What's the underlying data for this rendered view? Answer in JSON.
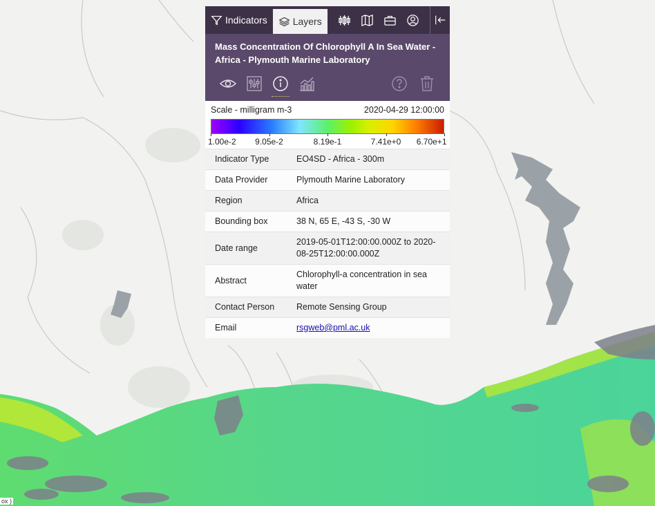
{
  "tabs": {
    "indicators": "Indicators",
    "layers": "Layers"
  },
  "toolbar_icons": [
    "compare-icon",
    "map-icon",
    "briefcase-icon",
    "user-icon",
    "collapse-left-icon"
  ],
  "layer": {
    "title": "Mass Concentration Of Chlorophyll A In Sea Water - Africa - Plymouth Marine Laboratory",
    "tools": [
      "eye-icon",
      "sliders-icon",
      "info-icon",
      "chart-icon",
      "help-icon",
      "trash-icon"
    ]
  },
  "legend": {
    "scale_label": "Scale - milligram m-3",
    "date": "2020-04-29 12:00:00",
    "ticks": [
      "1.00e-2",
      "9.05e-2",
      "8.19e-1",
      "7.41e+0",
      "6.70e+1"
    ]
  },
  "metadata": [
    {
      "key": "Indicator Type",
      "value": "EO4SD - Africa - 300m"
    },
    {
      "key": "Data Provider",
      "value": "Plymouth Marine Laboratory"
    },
    {
      "key": "Region",
      "value": "Africa"
    },
    {
      "key": "Bounding box",
      "value": "38 N, 65 E, -43 S, -30 W"
    },
    {
      "key": "Date range",
      "value": "2019-05-01T12:00:00.000Z to 2020-08-25T12:00:00.000Z"
    },
    {
      "key": "Abstract",
      "value": "Chlorophyll-a concentration in sea water"
    },
    {
      "key": "Contact Person",
      "value": "Remote Sensing Group"
    },
    {
      "key": "Email",
      "value": "rsgweb@pml.ac.uk",
      "link": true
    }
  ],
  "corner_text": "ox )"
}
